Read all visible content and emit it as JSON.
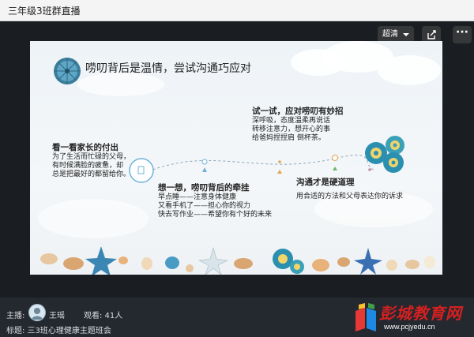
{
  "window": {
    "title": "三年级3班群直播"
  },
  "player": {
    "quality_label": "超清"
  },
  "slide": {
    "title": "唠叨背后是温情，尝试沟通巧应对",
    "block1": {
      "heading": "看一看家长的付出",
      "lines": [
        "为了生活而忙碌的父母，",
        "有时候满脸的疲惫，却",
        "总是把最好的都留给你。"
      ]
    },
    "block2": {
      "heading": "想一想，唠叨背后的牵挂",
      "lines": [
        "早点睡——注意身体健康",
        "又看手机了——担心你的视力",
        "快去写作业——希望你有个好的未来"
      ]
    },
    "block3": {
      "heading": "试一试，应对唠叨有妙招",
      "lines": [
        "深呼吸，态度温柔再说话",
        "转移注意力，想开心的事",
        "给爸妈捏捏肩 倒杯茶。"
      ]
    },
    "block4": {
      "heading": "沟通才是硬道理",
      "lines": [
        "用合适的方法和父母表达你的诉求"
      ]
    }
  },
  "footer": {
    "host_label": "主播:",
    "host_name": "王瑶",
    "viewers": "观看: 41人",
    "topic": "标题: 三3班心理健康主题班会"
  },
  "watermark": {
    "name": "彭城教育网",
    "url": "www.pcjyedu.cn"
  }
}
